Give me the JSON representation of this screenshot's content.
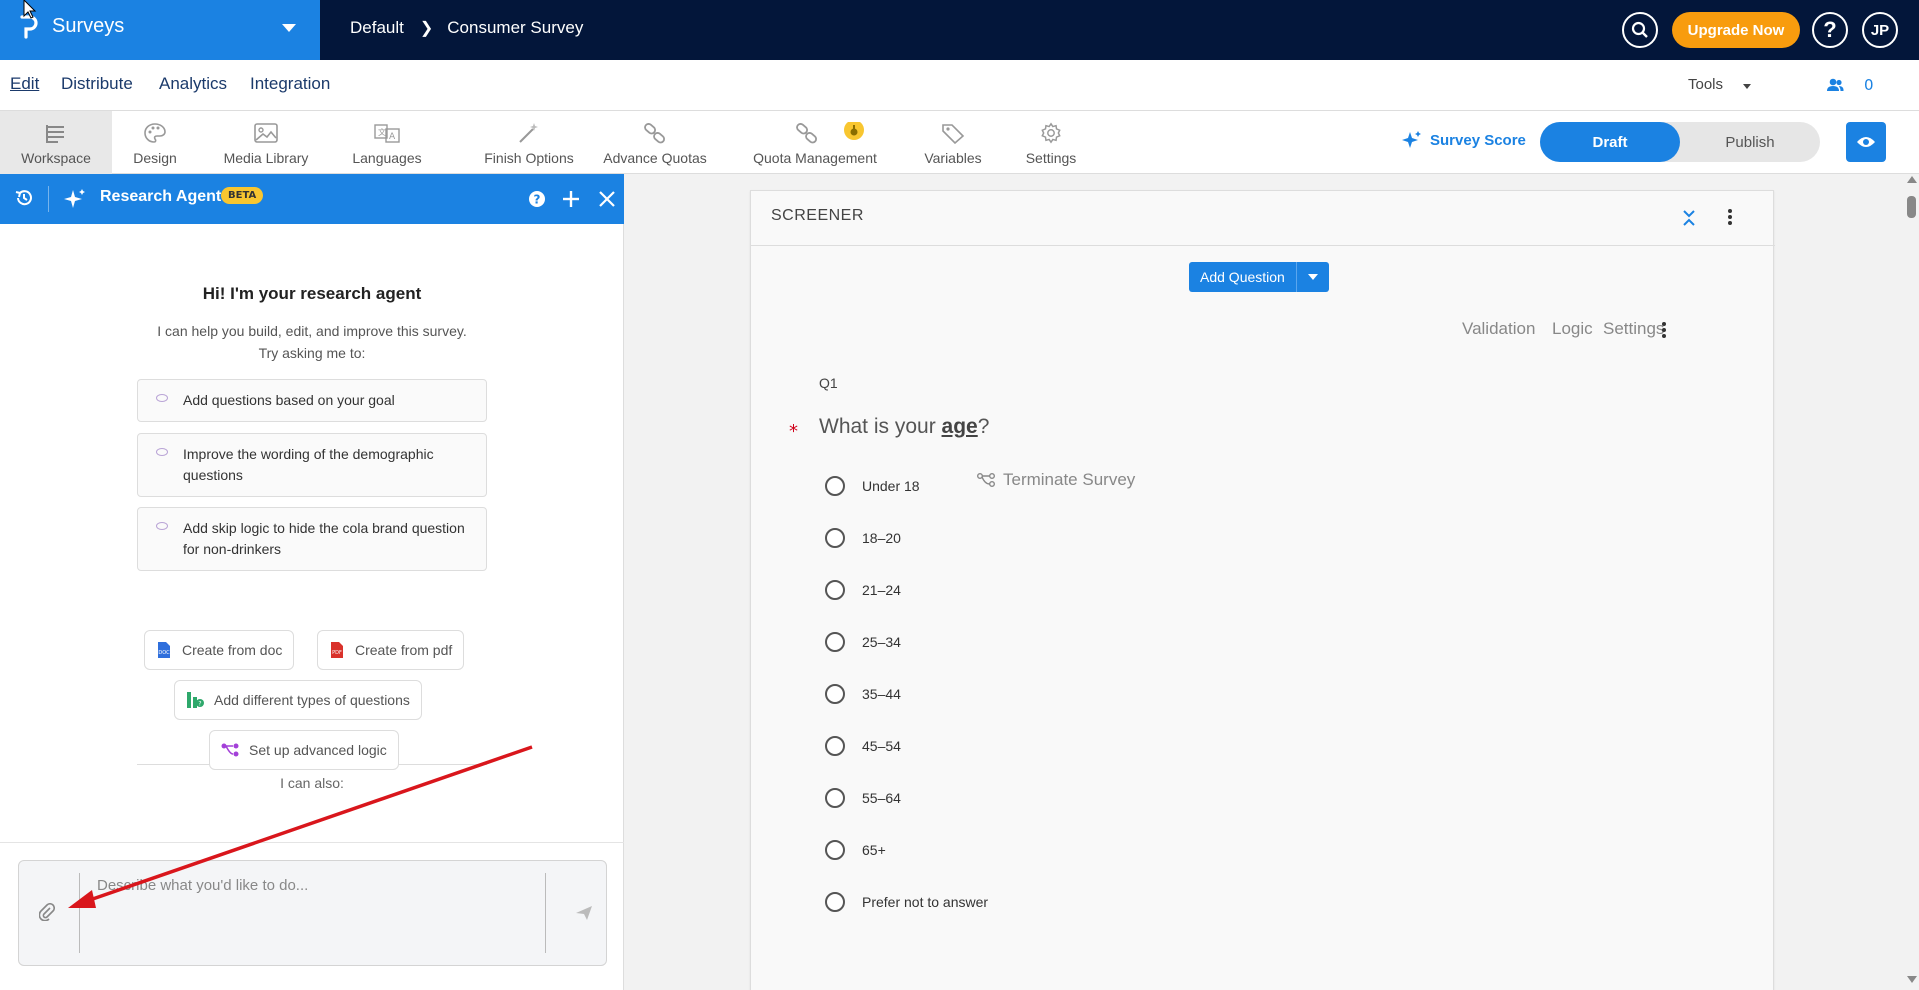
{
  "app": {
    "name": "Surveys",
    "breadcrumb": [
      "Default",
      "Consumer Survey"
    ],
    "upgrade_label": "Upgrade Now",
    "help_label": "?",
    "avatar_initials": "JP",
    "brand_color": "#1b82e2",
    "nav_color": "#03163a",
    "upgrade_color": "#f89c0e"
  },
  "menu": {
    "items": [
      "Edit",
      "Distribute",
      "Analytics",
      "Integration"
    ],
    "active": "Edit",
    "tools_label": "Tools",
    "collaborators_count": "0"
  },
  "toolbar": {
    "items": [
      {
        "label": "Workspace",
        "icon": "workspace-icon"
      },
      {
        "label": "Design",
        "icon": "palette-icon"
      },
      {
        "label": "Media Library",
        "icon": "image-icon"
      },
      {
        "label": "Languages",
        "icon": "translate-icon"
      },
      {
        "label": "Finish Options",
        "icon": "magic-wand-icon"
      },
      {
        "label": "Advance Quotas",
        "icon": "chain-icon"
      },
      {
        "label": "Quota Management",
        "icon": "chain-badge-icon"
      },
      {
        "label": "Variables",
        "icon": "tag-icon"
      },
      {
        "label": "Settings",
        "icon": "gear-icon"
      }
    ],
    "survey_score_label": "Survey Score",
    "draft_label": "Draft",
    "publish_label": "Publish"
  },
  "agent": {
    "title": "Research Agent",
    "badge": "BETA",
    "greeting": "Hi! I'm your research agent",
    "intro_line1": "I can help you build, edit, and improve this survey.",
    "intro_line2": "Try asking me to:",
    "suggestions": [
      "Add questions based on your goal",
      "Improve the wording of the demographic questions",
      "Add skip logic to hide the cola brand question for non-drinkers"
    ],
    "also_label": "I can also:",
    "chips": [
      {
        "label": "Create from doc",
        "icon": "doc-icon"
      },
      {
        "label": "Create from pdf",
        "icon": "pdf-icon"
      },
      {
        "label": "Add different types of questions",
        "icon": "question-types-icon"
      },
      {
        "label": "Set up advanced logic",
        "icon": "logic-icon"
      }
    ],
    "input_placeholder": "Describe what you'd like to do..."
  },
  "block": {
    "title": "SCREENER",
    "add_question_label": "Add Question",
    "question_tools": [
      "Validation",
      "Logic",
      "Settings"
    ],
    "question": {
      "number": "Q1",
      "text_before": "What is your ",
      "text_keyword": "age",
      "text_after": "?",
      "required_mark": "*",
      "options": [
        "Under 18",
        "18–20",
        "21–24",
        "25–34",
        "35–44",
        "45–54",
        "55–64",
        "65+",
        "Prefer not to answer"
      ],
      "terminate_label": "Terminate Survey"
    }
  }
}
